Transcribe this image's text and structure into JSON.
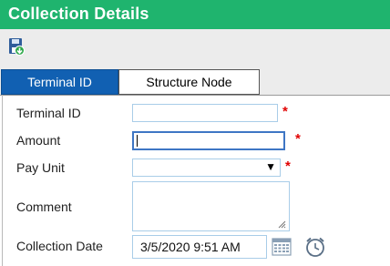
{
  "header": {
    "title": "Collection Details"
  },
  "toolbar": {
    "save_icon": "save-icon"
  },
  "tabs": [
    {
      "label": "Terminal ID",
      "active": true
    },
    {
      "label": "Structure Node",
      "active": false
    }
  ],
  "form": {
    "terminal_id": {
      "label": "Terminal ID",
      "value": "",
      "required": "*"
    },
    "amount": {
      "label": "Amount",
      "value": "",
      "required": "*"
    },
    "pay_unit": {
      "label": "Pay Unit",
      "value": "",
      "required": "*"
    },
    "comment": {
      "label": "Comment",
      "value": ""
    },
    "collection_date": {
      "label": "Collection Date",
      "value": "3/5/2020 9:51 AM"
    }
  },
  "colors": {
    "header_bg": "#1fb46e",
    "active_tab_bg": "#1160b2",
    "required_star": "#e10000",
    "input_border": "#a9cde8"
  }
}
